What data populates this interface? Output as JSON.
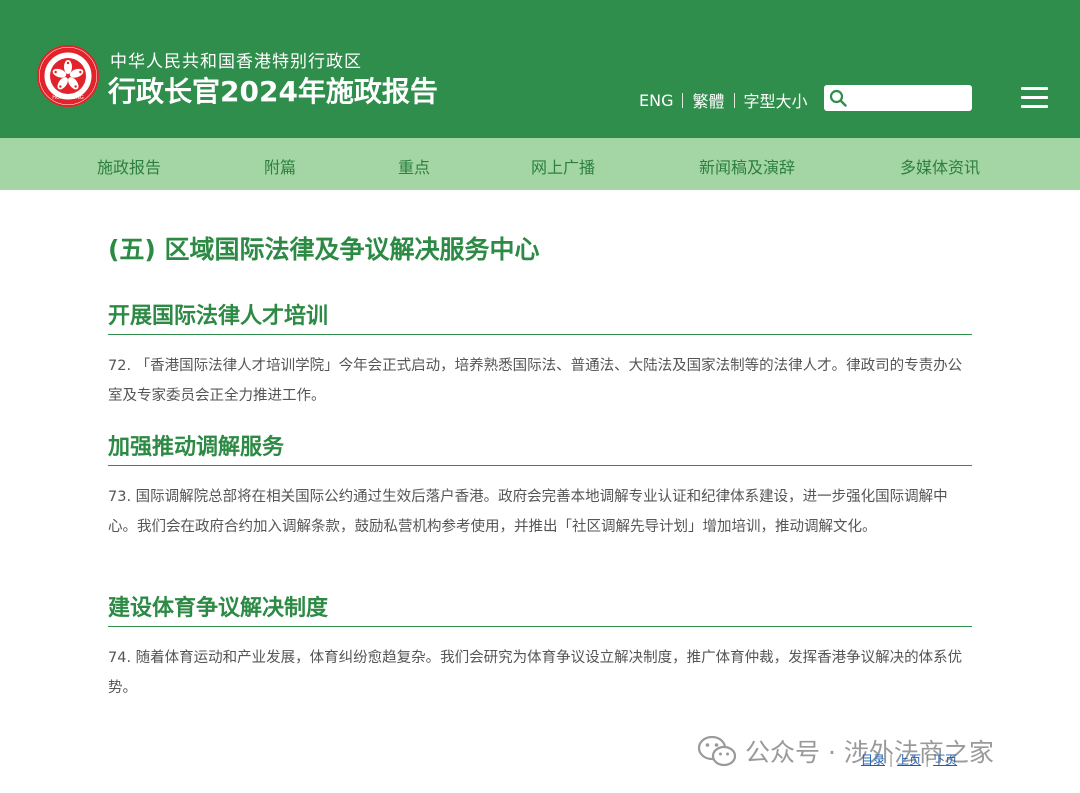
{
  "header": {
    "org_name": "中华人民共和国香港特别行政区",
    "report_title": "行政长官2024年施政报告",
    "lang_eng": "ENG",
    "lang_trad": "繁體",
    "font_size": "字型大小",
    "search_placeholder": "",
    "emblem_text": "HONG KONG",
    "icons": [
      "hk-emblem-icon",
      "search-icon",
      "hamburger-menu-icon"
    ]
  },
  "nav": {
    "items": [
      {
        "label": "施政报告"
      },
      {
        "label": "附篇"
      },
      {
        "label": "重点"
      },
      {
        "label": "网上广播"
      },
      {
        "label": "新闻稿及演辞"
      },
      {
        "label": "多媒体资讯"
      }
    ]
  },
  "content": {
    "section_title": "(五) 区域国际法律及争议解决服务中心",
    "subsections": [
      {
        "heading": "开展国际法律人才培训",
        "paragraph": "72. 「香港国际法律人才培训学院」今年会正式启动，培养熟悉国际法、普通法、大陆法及国家法制等的法律人才。律政司的专责办公室及专家委员会正全力推进工作。"
      },
      {
        "heading": "加强推动调解服务",
        "paragraph": "73. 国际调解院总部将在相关国际公约通过生效后落户香港。政府会完善本地调解专业认证和纪律体系建设，进一步强化国际调解中心。我们会在政府合约加入调解条款，鼓励私营机构参考使用，并推出「社区调解先导计划」增加培训，推动调解文化。"
      },
      {
        "heading": "建设体育争议解决制度",
        "paragraph": "74. 随着体育运动和产业发展，体育纠纷愈趋复杂。我们会研究为体育争议设立解决制度，推广体育仲裁，发挥香港争议解决的体系优势。"
      }
    ]
  },
  "pager": {
    "contents": "目录",
    "prev": "上页",
    "next": "下页"
  },
  "watermark": {
    "text": "公众号 · 涉外法商之家",
    "icon": "wechat-icon"
  },
  "colors": {
    "header_bg": "#2f8e4b",
    "nav_bg": "#a3d6a4",
    "nav_text": "#2e7f3f",
    "heading_green": "#2d8a45",
    "body_text": "#555555",
    "emblem_red": "#e2232a"
  }
}
